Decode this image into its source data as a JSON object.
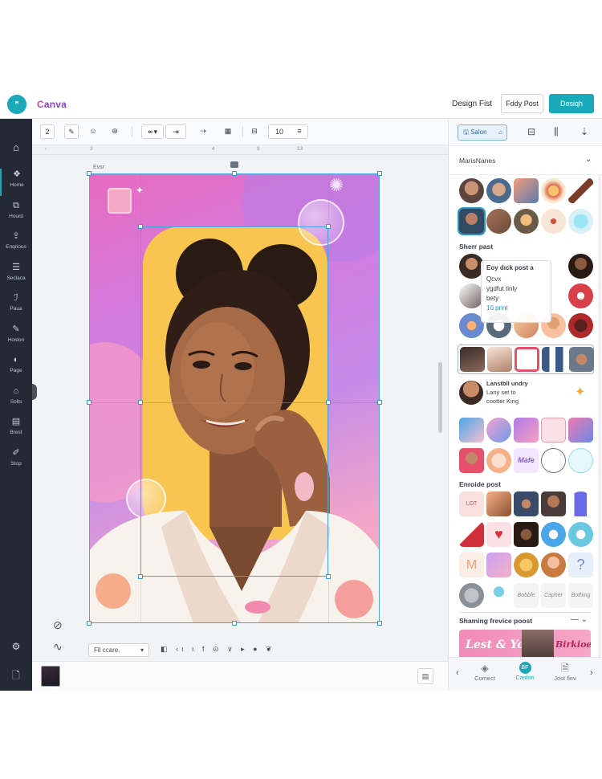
{
  "app": {
    "logo_text": "ꟸ",
    "brand": "Canva",
    "design_first": "Design Fist",
    "post_button": "Fddy Post",
    "design_button": "Desiqh"
  },
  "sidebar": {
    "home_icon": "home-icon",
    "items": [
      {
        "label": "Home",
        "icon": "shapes-icon",
        "glyph": "❖"
      },
      {
        "label": "Hourd",
        "icon": "copy-icon",
        "glyph": "⧉"
      },
      {
        "label": "Enqrious",
        "icon": "upload-icon",
        "glyph": "⇪"
      },
      {
        "label": "Seclaca",
        "icon": "layers-icon",
        "glyph": "☰"
      },
      {
        "label": "Paua",
        "icon": "text-icon",
        "glyph": "ℐ"
      },
      {
        "label": "Hoston",
        "icon": "draw-icon",
        "glyph": "✎"
      },
      {
        "label": "Page",
        "icon": "page-icon",
        "glyph": "◐"
      },
      {
        "label": "Solts",
        "icon": "apps-icon",
        "glyph": "⌂"
      },
      {
        "label": "Brest",
        "icon": "brand-icon",
        "glyph": "▤"
      },
      {
        "label": "Stop",
        "icon": "pen-icon",
        "glyph": "✐"
      }
    ],
    "bottom": [
      "settings-icon",
      "file-icon"
    ]
  },
  "toolbar": {
    "page_number": "2",
    "font_size": "10",
    "buttons": [
      "brush-icon",
      "smile-icon",
      "effects-icon",
      "align-left-icon",
      "arrow-right-icon",
      "arrow-end-icon",
      "image-icon",
      "layers-icon"
    ]
  },
  "ruler": {
    "ticks": [
      "3",
      "4",
      "9",
      "13"
    ]
  },
  "canvas": {
    "page_label": "Evsr",
    "fill_select": "Fll ccare.",
    "bottom_tools": "◧ ‹ı ı f ⊙ ∨ ▸ ● ❦"
  },
  "right_panel": {
    "select_label": "Salon",
    "search_label": "MarisNanes",
    "sections": {
      "share_post": "Sherr past",
      "enroide_post": "Enroide post",
      "sharing_post": "Shaming frevice poost"
    },
    "tooltip": {
      "line1": "Eoy dıck post a",
      "line2": "Qcvx",
      "line3": "ygdfut tinly",
      "line4": "bety",
      "line5": "10 print"
    },
    "user_card": {
      "title": "Lanstbll undry",
      "line2": "Lany set to",
      "line3": "cootter King"
    },
    "banner": {
      "left_text": "Lest & Yole",
      "right_text": "Birkioe"
    },
    "bottom_tabs": [
      {
        "label": "Comect",
        "icon": "connect-icon"
      },
      {
        "label": "Caslon",
        "icon": "brand-badge-icon"
      },
      {
        "label": "Jost flev",
        "icon": "doc-icon"
      }
    ]
  },
  "colors": {
    "accent": "#1aa9b8",
    "sidebar_bg": "#232a35",
    "selection": "#4aa6d6"
  }
}
